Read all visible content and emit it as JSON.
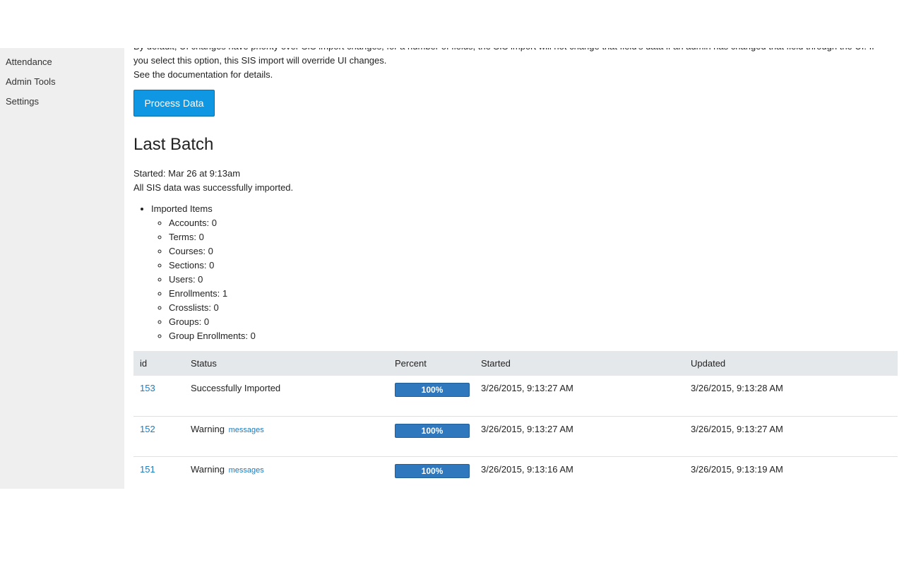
{
  "sidebar": {
    "items": [
      {
        "label": "Attendance"
      },
      {
        "label": "Admin Tools"
      },
      {
        "label": "Settings"
      }
    ]
  },
  "intro": {
    "line1": "By default, UI changes have priority over SIS import changes; for a number of fields, the SIS import will not change that field's data if an admin has changed that field through the UI. If",
    "line2": "you select this option, this SIS import will override UI changes.",
    "line3": "See the documentation for details."
  },
  "process_button": {
    "label": "Process Data"
  },
  "last_batch": {
    "title": "Last Batch",
    "started": "Started: Mar 26 at 9:13am",
    "status": "All SIS data was successfully imported.",
    "imported_label": "Imported Items",
    "items": [
      {
        "text": "Accounts: 0"
      },
      {
        "text": "Terms: 0"
      },
      {
        "text": "Courses: 0"
      },
      {
        "text": "Sections: 0"
      },
      {
        "text": "Users: 0"
      },
      {
        "text": "Enrollments: 1"
      },
      {
        "text": "Crosslists: 0"
      },
      {
        "text": "Groups: 0"
      },
      {
        "text": "Group Enrollments: 0"
      }
    ]
  },
  "table": {
    "headers": {
      "id": "id",
      "status": "Status",
      "percent": "Percent",
      "started": "Started",
      "updated": "Updated"
    },
    "rows": [
      {
        "id": "153",
        "status": "Successfully Imported",
        "messages": "",
        "percent": 100,
        "percent_label": "100%",
        "started": "3/26/2015, 9:13:27 AM",
        "updated": "3/26/2015, 9:13:28 AM"
      },
      {
        "id": "152",
        "status": "Warning",
        "messages": "messages",
        "percent": 100,
        "percent_label": "100%",
        "started": "3/26/2015, 9:13:27 AM",
        "updated": "3/26/2015, 9:13:27 AM"
      },
      {
        "id": "151",
        "status": "Warning",
        "messages": "messages",
        "percent": 100,
        "percent_label": "100%",
        "started": "3/26/2015, 9:13:16 AM",
        "updated": "3/26/2015, 9:13:19 AM"
      }
    ]
  },
  "colors": {
    "button": "#0f97e3",
    "progress": "#2f78bd",
    "link": "#1a7bbf",
    "sidebar_bg": "#efefef",
    "table_header_bg": "#e4e8eb"
  }
}
